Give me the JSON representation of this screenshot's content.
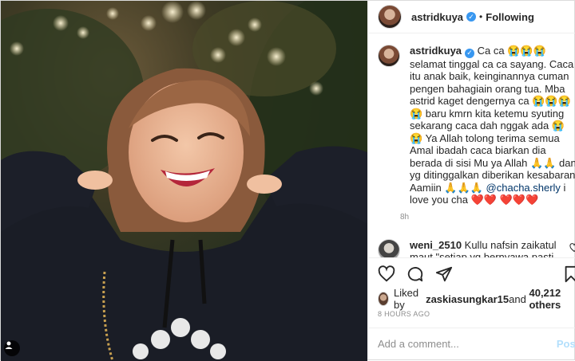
{
  "post": {
    "username": "astridkuya",
    "follow_status": "Following",
    "separator": "•",
    "caption": {
      "username": "astridkuya",
      "text_1": " Ca ca 😭😭😭 selamat tinggal ca ca sayang. Caca itu anak baik, keinginannya cuman pengen bahagiain orang tua. Mba astrid kaget dengernya ca 😭😭😭😭 baru kmrn kita ketemu syuting sekarang caca dah nggak ada 😭😭 Ya Allah tolong terima semua Amal ibadah caca biarkan dia berada di sisi Mu ya Allah 🙏🙏 dan yg ditinggalkan diberikan kesabaran Aamiin 🙏🙏🙏 ",
      "mention": "@chacha.sherly",
      "text_2": " i love you cha ❤️❤️ ❤️❤️❤️",
      "age": "8h"
    },
    "comment": {
      "username": "weni_2510",
      "text": " Kullu nafsin zaikatul maut \"setiap yg bernyawa pasti akan mati\" Semoga husnul"
    },
    "likes": {
      "prefix": "Liked by ",
      "user": "zaskiasungkar15",
      "middle": " and ",
      "count": "40,212 others"
    },
    "timestamp": "8 HOURS AGO",
    "add_comment_placeholder": "Add a comment...",
    "post_button": "Post"
  },
  "icons": {
    "like": "heart-icon",
    "comment": "comment-icon",
    "share": "share-icon",
    "save": "bookmark-icon",
    "tag": "user-tag-icon",
    "verified": "verified-badge-icon"
  },
  "colors": {
    "link": "#003569",
    "verified": "#3897f0",
    "post_button_disabled": "#b2dffc",
    "secondary_text": "#8e8e8e"
  }
}
